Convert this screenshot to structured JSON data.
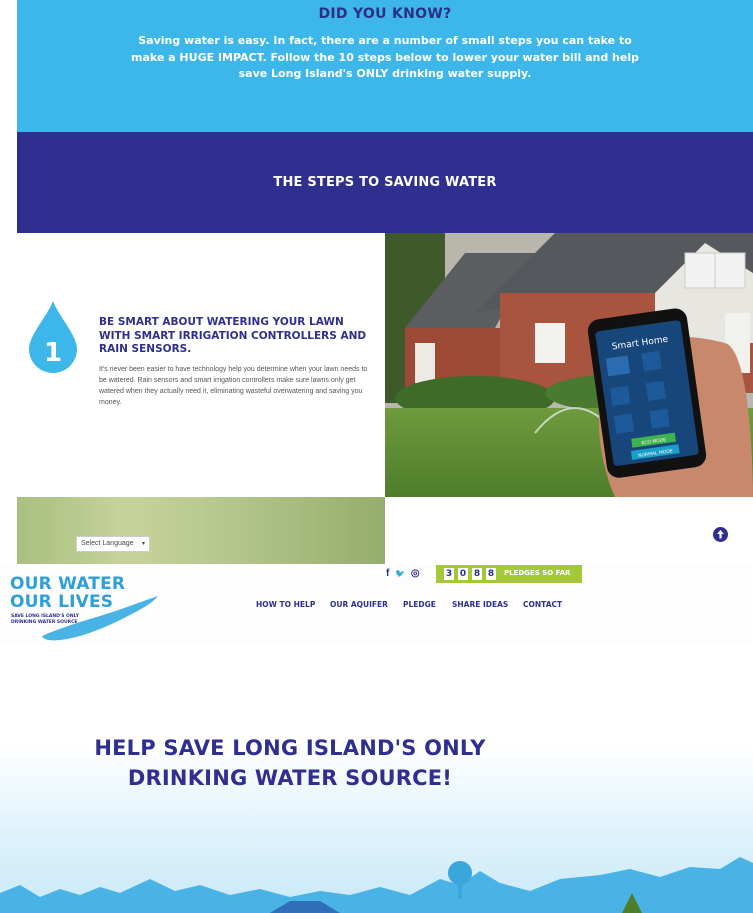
{
  "did_you_know": {
    "title": "DID YOU KNOW?",
    "text": "Saving water is easy. In fact, there are a number of small steps you can take to make a HUGE IMPACT. Follow the 10 steps below to lower your water bill and help save Long Island's ONLY drinking water supply."
  },
  "steps_banner": {
    "title": "THE STEPS TO SAVING WATER"
  },
  "step1": {
    "number": "1",
    "title": "BE SMART ABOUT WATERING YOUR LAWN WITH SMART IRRIGATION CONTROLLERS AND RAIN SENSORS.",
    "body": "It's never been easier to have technology help you determine when your lawn needs to be watered. Rain sensors and smart irrigation controllers make sure lawns only get watered when they actually need it, eliminating wasteful overwatering and saving you money.",
    "phone": {
      "title": "Smart Home",
      "eco_button": "ECO MODE",
      "normal_button": "NORMAL MODE"
    }
  },
  "language_select": {
    "label": "Select Language",
    "caret": "▾"
  },
  "scroll_top_icon": "arrow-up-icon",
  "header": {
    "logo": {
      "line1": "OUR WATER",
      "line2": "OUR LIVES",
      "tagline": "SAVE LONG ISLAND'S ONLY DRINKING WATER SOURCE"
    },
    "social": {
      "facebook": "f",
      "twitter": "🐦",
      "instagram": "◎"
    },
    "pledges": {
      "digits": [
        "3",
        "0",
        "8",
        "8"
      ],
      "label": "PLEDGES SO FAR"
    },
    "nav": [
      "HOW TO HELP",
      "OUR AQUIFER",
      "PLEDGE",
      "SHARE IDEAS",
      "CONTACT"
    ]
  },
  "hero": {
    "title": "HELP SAVE LONG ISLAND'S ONLY DRINKING WATER SOURCE!"
  },
  "colors": {
    "light_blue": "#3db6ea",
    "navy": "#2e2f8f",
    "green": "#a3c93a",
    "logo_blue": "#2f9fd8"
  }
}
